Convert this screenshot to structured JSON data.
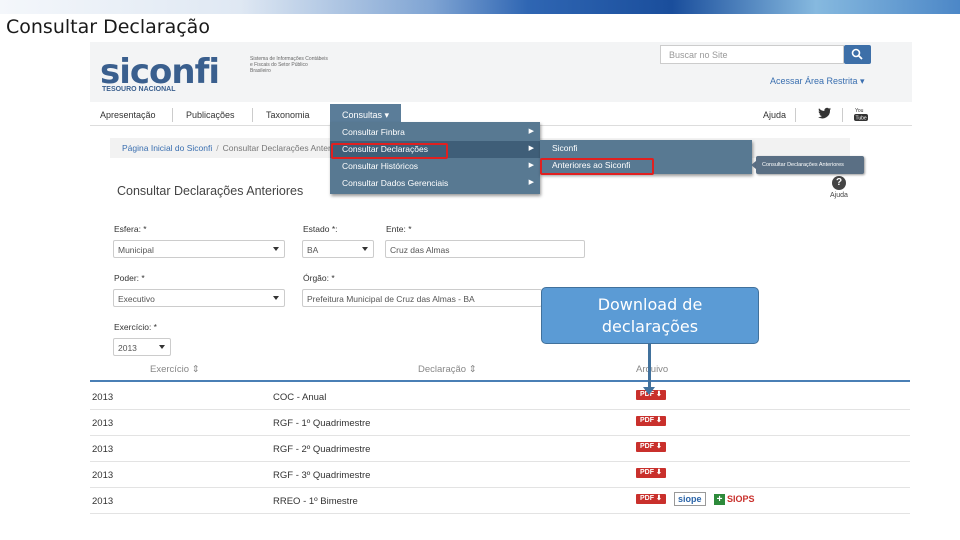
{
  "slide": {
    "title": "Consultar Declaração"
  },
  "header": {
    "logo": "siconfi",
    "logo_sub": "Sistema de Informações Contábeis e Fiscais do Setor Público Brasileiro",
    "logo_tn": "TESOURO NACIONAL",
    "search_placeholder": "Buscar no Site",
    "restricted_link": "Acessar Área Restrita ▾"
  },
  "nav": {
    "items": [
      "Apresentação",
      "Publicações",
      "Taxonomia",
      "Consultas ▾",
      "Ajuda"
    ]
  },
  "breadcrumb": {
    "home": "Página Inicial do Siconfi",
    "sep": "/",
    "current": "Consultar Declarações Anteriores"
  },
  "page": {
    "title": "Consultar Declarações Anteriores",
    "help_label": "Ajuda"
  },
  "menus": {
    "consultas": [
      "Consultar Finbra",
      "Consultar Declarações",
      "Consultar Históricos",
      "Consultar Dados Gerenciais"
    ],
    "declaracoes": [
      "Siconfi",
      "Anteriores ao Siconfi"
    ],
    "tooltip": "Consultar Declarações Anteriores"
  },
  "form": {
    "esfera": {
      "label": "Esfera: *",
      "value": "Municipal"
    },
    "estado": {
      "label": "Estado *:",
      "value": "BA"
    },
    "ente": {
      "label": "Ente: *",
      "value": "Cruz das Almas"
    },
    "poder": {
      "label": "Poder: *",
      "value": "Executivo"
    },
    "orgao": {
      "label": "Órgão: *",
      "value": "Prefeitura Municipal de Cruz das Almas - BA"
    },
    "exercicio": {
      "label": "Exercício: *",
      "value": "2013"
    }
  },
  "table": {
    "headers": [
      "Exercício ⇕",
      "Declaração ⇕",
      "Arquivo"
    ],
    "rows": [
      {
        "year": "2013",
        "decl": "COC - Anual",
        "file": "PDF ⬇"
      },
      {
        "year": "2013",
        "decl": "RGF - 1º Quadrimestre",
        "file": "PDF ⬇"
      },
      {
        "year": "2013",
        "decl": "RGF - 2º Quadrimestre",
        "file": "PDF ⬇"
      },
      {
        "year": "2013",
        "decl": "RGF - 3º Quadrimestre",
        "file": "PDF ⬇"
      },
      {
        "year": "2013",
        "decl": "RREO - 1º Bimestre",
        "file": "PDF ⬇"
      }
    ],
    "siope": "siope",
    "siops": "SIOPS"
  },
  "callout": {
    "line1": "Download de",
    "line2": "declarações"
  },
  "colors": {
    "accent": "#5b9bd5",
    "menu": "#587992",
    "highlight": "#e02020",
    "pdf": "#c9302c"
  }
}
